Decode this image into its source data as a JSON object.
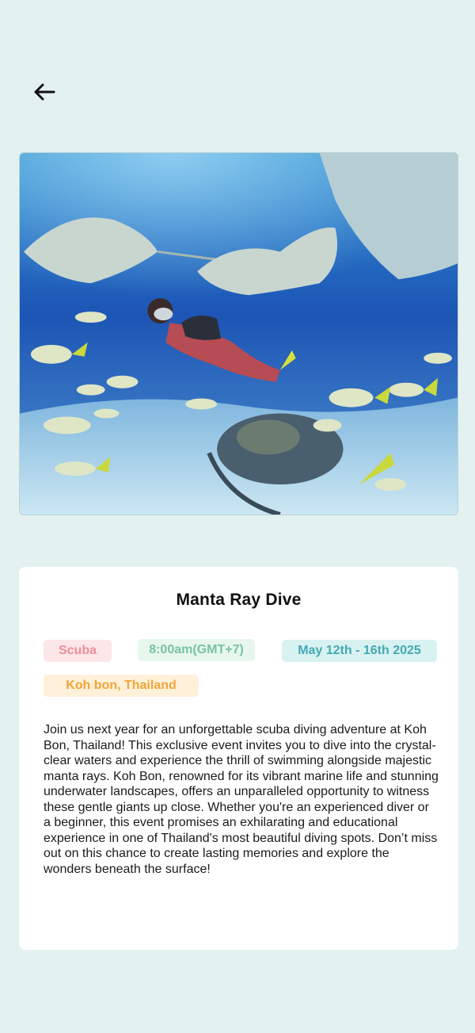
{
  "header": {
    "back_icon": "arrow-left-icon"
  },
  "hero": {
    "image_description_icon": "underwater-photo"
  },
  "event": {
    "title": "Manta Ray Dive",
    "category": "Scuba",
    "time": "8:00am(GMT+7)",
    "dates": "May 12th - 16th 2025",
    "location": "Koh bon, Thailand",
    "description": "Join us next year for an unforgettable scuba diving adventure at Koh Bon, Thailand! This exclusive event invites you to dive into the crystal-clear waters and experience the thrill of swimming alongside majestic manta rays. Koh Bon, renowned for its vibrant marine life and stunning underwater landscapes, offers an unparalleled opportunity to witness these gentle giants up close. Whether you're an experienced diver or a beginner, this event promises an exhilarating and educational experience in one of Thailand's most beautiful diving spots. Don’t miss out on this chance to create lasting memories and explore the wonders beneath the surface!"
  },
  "colors": {
    "background": "#e3f1f0",
    "card": "#ffffff",
    "category_bg": "#fde6e8",
    "category_text": "#ee8e9a",
    "time_bg": "#e7f7ee",
    "time_text": "#79c3a0",
    "date_bg": "#d8f2f2",
    "date_text": "#43aab0",
    "location_bg": "#fff1d9",
    "location_text": "#f1a43a"
  }
}
